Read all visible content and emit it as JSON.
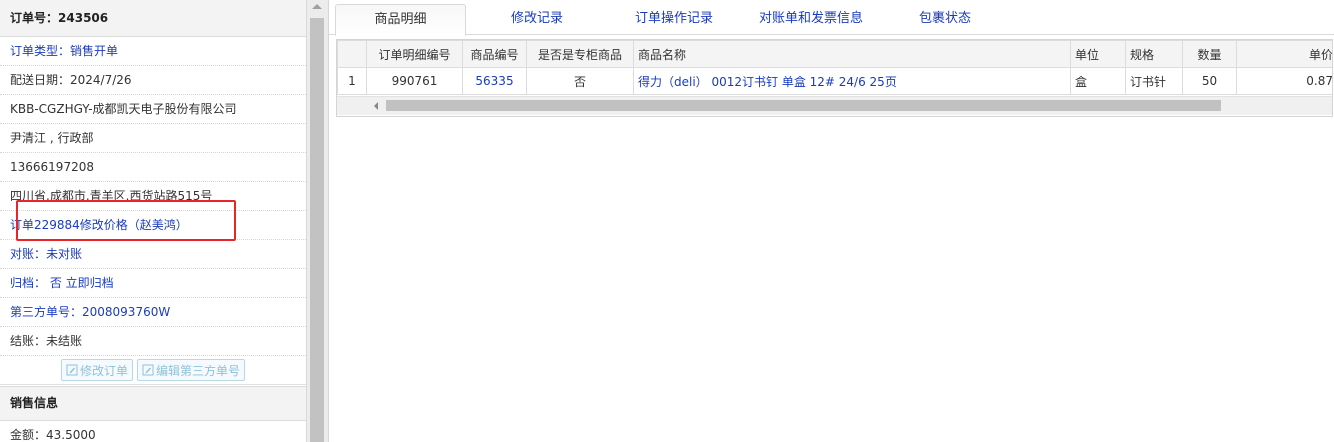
{
  "left_panel": {
    "order_no_label": "订单号：",
    "order_no": "243506",
    "order_type": "订单类型：销售开单",
    "delivery_date": "配送日期：2024/7/26",
    "company": "KBB-CGZHGY-成都凯天电子股份有限公司",
    "contact": "尹清江 , 行政部",
    "phone": "13666197208",
    "address": "四川省.成都市.青羊区.西货站路515号",
    "price_change": "订单229884修改价格（赵美鸿）",
    "reconcile": "对账：未对账",
    "archive": "归档：  否 立即归档",
    "third_party": "第三方单号：2008093760W",
    "settlement": "结账：未结账",
    "btn_edit_order": "修改订单",
    "btn_edit_third": "编辑第三方单号",
    "sales_info_title": "销售信息",
    "amount": "金额：43.5000"
  },
  "tabs": [
    "商品明细",
    "修改记录",
    "订单操作记录",
    "对账单和发票信息",
    "包裹状态"
  ],
  "active_tab": 0,
  "table": {
    "headers": [
      "",
      "订单明细编号",
      "商品编号",
      "是否是专柜商品",
      "商品名称",
      "单位",
      "规格",
      "数量",
      "单价"
    ],
    "rows": [
      [
        "1",
        "990761",
        "56335",
        "否",
        "得力（deli） 0012订书钉 单盒 12# 24/6 25页",
        "盒",
        "订书针",
        "50",
        "0.87"
      ]
    ]
  },
  "icons": [
    "edit-icon",
    "edit-icon"
  ],
  "colors": {
    "link": "#1a3bbd",
    "highlight": "#e8262a"
  }
}
